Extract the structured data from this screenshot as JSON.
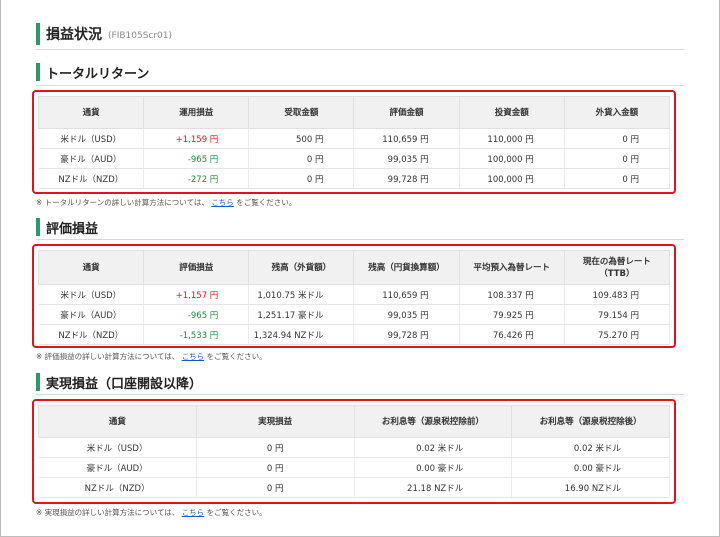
{
  "page": {
    "title": "損益状況",
    "screen_id": "(FIB105Scr01)"
  },
  "sections": {
    "total": {
      "title": "トータルリターン",
      "headers": [
        "通貨",
        "運用損益",
        "受取金額",
        "評価金額",
        "投資金額",
        "外貨入金額"
      ],
      "rows": [
        [
          "米ドル（USD）",
          "+1,159 円",
          "500 円",
          "110,659 円",
          "110,000 円",
          "0 円"
        ],
        [
          "豪ドル（AUD）",
          "-965 円",
          "0 円",
          "99,035 円",
          "100,000 円",
          "0 円"
        ],
        [
          "NZドル（NZD）",
          "-272 円",
          "0 円",
          "99,728 円",
          "100,000 円",
          "0 円"
        ]
      ],
      "note_before": "※ トータルリターンの詳しい計算方法については、",
      "note_link": "こちら",
      "note_after": "をご覧ください。"
    },
    "valuation": {
      "title": "評価損益",
      "headers": [
        "通貨",
        "評価損益",
        "残高（外貨額）",
        "残高（円貨換算額）",
        "平均預入為替レート",
        "現在の為替レート\n（TTB）"
      ],
      "rows": [
        [
          "米ドル（USD）",
          "+1,157 円",
          "1,010.75 米ドル",
          "110,659 円",
          "108.337 円",
          "109.483 円"
        ],
        [
          "豪ドル（AUD）",
          "-965 円",
          "1,251.17 豪ドル",
          "99,035 円",
          "79.925 円",
          "79.154 円"
        ],
        [
          "NZドル（NZD）",
          "-1,533 円",
          "1,324.94 NZドル",
          "99,728 円",
          "76.426 円",
          "75.270 円"
        ]
      ],
      "note_before": "※ 評価損益の詳しい計算方法については、",
      "note_link": "こちら",
      "note_after": "をご覧ください。"
    },
    "realized": {
      "title": "実現損益（口座開設以降）",
      "headers": [
        "通貨",
        "実現損益",
        "お利息等（源泉税控除前）",
        "お利息等（源泉税控除後）"
      ],
      "rows": [
        [
          "米ドル（USD）",
          "0 円",
          "0.02 米ドル",
          "0.02 米ドル"
        ],
        [
          "豪ドル（AUD）",
          "0 円",
          "0.00 豪ドル",
          "0.00 豪ドル"
        ],
        [
          "NZドル（NZD）",
          "0 円",
          "21.18 NZドル",
          "16.90 NZドル"
        ]
      ],
      "note_before": "※ 実現損益の詳しい計算方法については、",
      "note_link": "こちら",
      "note_after": "をご覧ください。"
    }
  },
  "colors": {
    "accent": "#2b9a6b",
    "highlight_border": "#e0141f",
    "gain": "#e0141f",
    "loss": "#1f8a3b",
    "link": "#1a57c4"
  }
}
